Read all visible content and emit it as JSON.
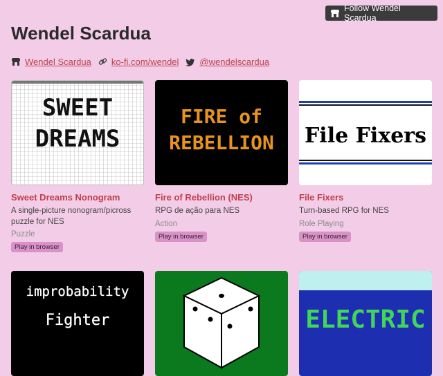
{
  "header": {
    "follow_label": "Follow Wendel Scardua",
    "title": "Wendel Scardua"
  },
  "links": [
    {
      "icon": "itchio-icon",
      "label": "Wendel Scardua"
    },
    {
      "icon": "link-icon",
      "label": "ko-fi.com/wendel"
    },
    {
      "icon": "twitter-icon",
      "label": "@wendelscardua"
    }
  ],
  "games": [
    {
      "title": "Sweet Dreams Nonogram",
      "description": "A single-picture nonogram/picross puzzle for NES",
      "genre": "Puzzle",
      "badge": "Play in browser",
      "thumb_text": [
        "SWEET",
        "DREAMS"
      ]
    },
    {
      "title": "Fire of Rebellion (NES)",
      "description": "RPG de ação para NES",
      "genre": "Action",
      "badge": "Play in browser",
      "thumb_text": [
        "FIRE of",
        "REBELLION"
      ]
    },
    {
      "title": "File Fixers",
      "description": "Turn-based RPG for NES",
      "genre": "Role Playing",
      "badge": "Play in browser",
      "thumb_text": [
        "File Fixers"
      ]
    },
    {
      "thumb_text": [
        "improbability",
        "Fighter"
      ]
    },
    {
      "thumb_text": []
    },
    {
      "thumb_text": [
        "ELECTRIC"
      ]
    }
  ],
  "colors": {
    "background": "#f3cde7",
    "accent": "#c0404c",
    "badge": "#d992c7",
    "button": "#3b3b3b"
  }
}
